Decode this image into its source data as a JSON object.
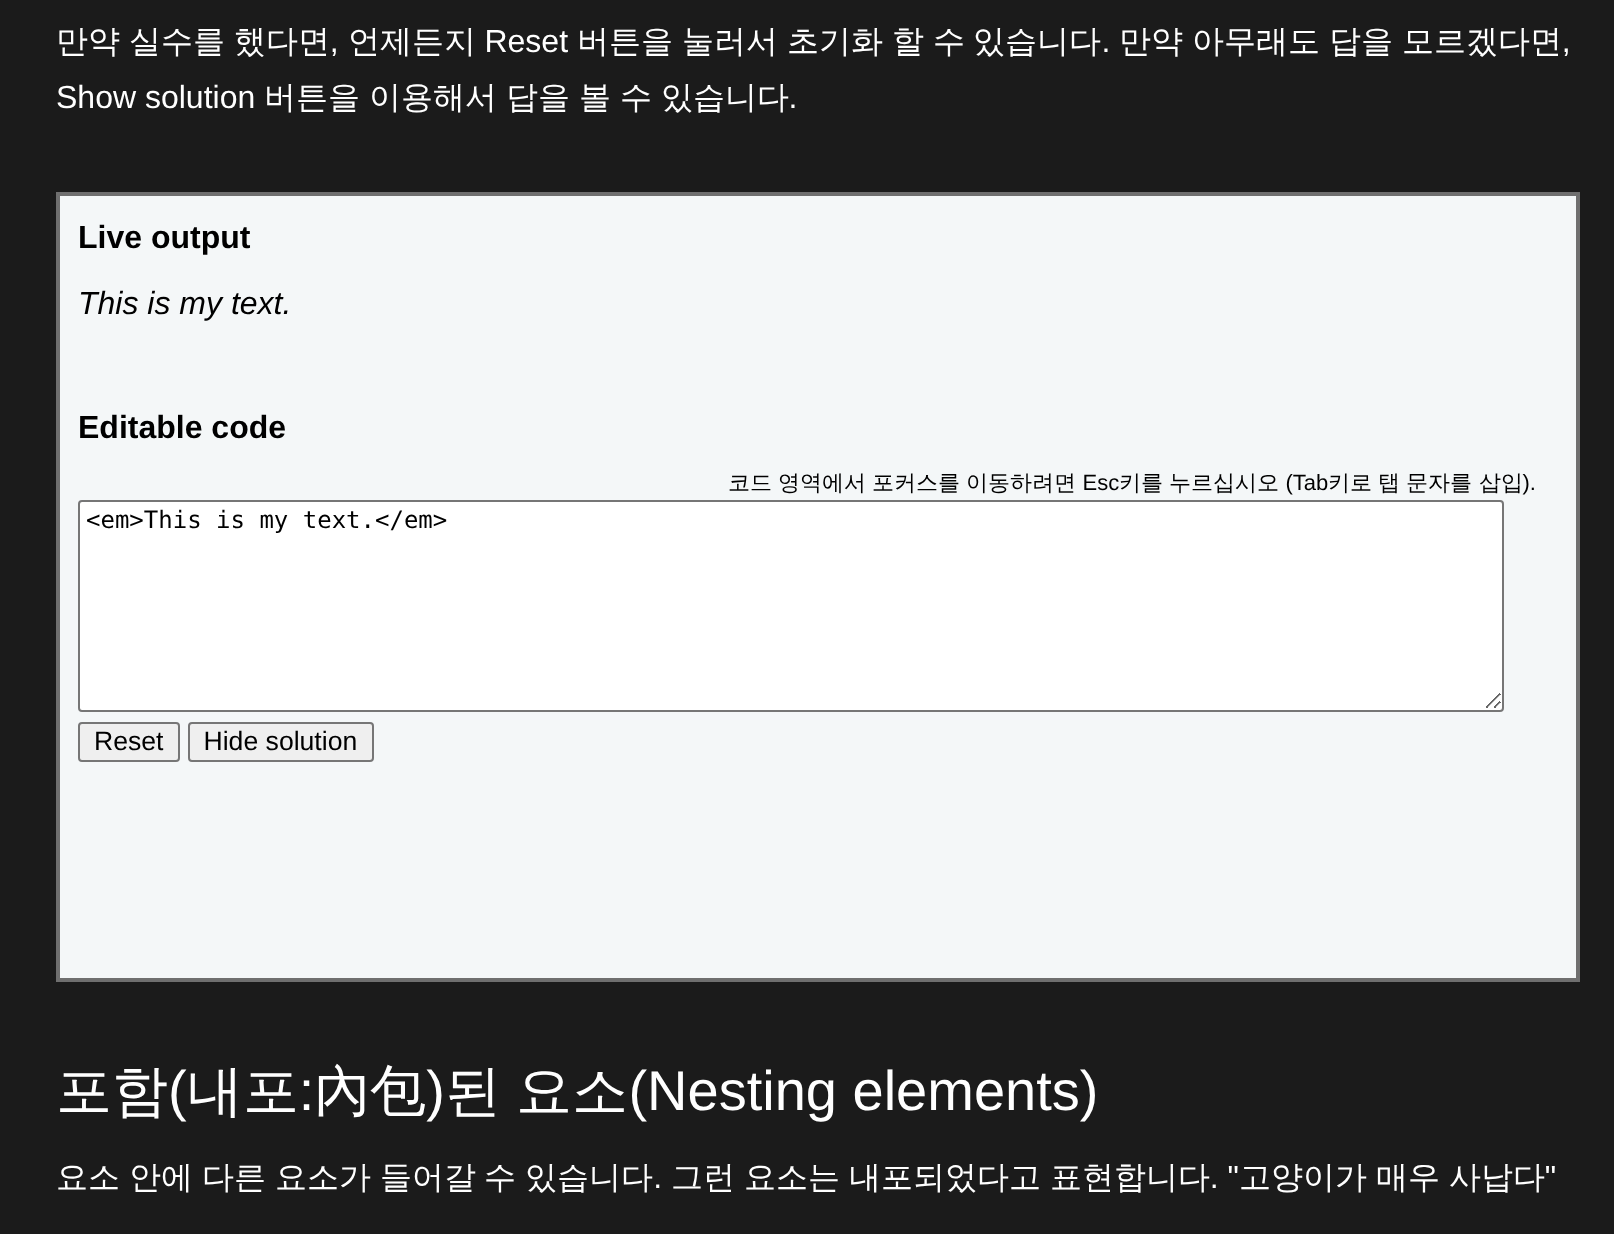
{
  "intro": "만약 실수를 했다면, 언제든지 Reset 버튼을 눌러서 초기화 할 수 있습니다. 만약 아무래도 답을 모르겠다면, Show solution 버튼을 이용해서 답을 볼 수 있습니다.",
  "example": {
    "output_heading": "Live output",
    "output_text": "This is my text.",
    "code_heading": "Editable code",
    "hint": "코드 영역에서 포커스를 이동하려면 Esc키를 누르십시오 (Tab키로 탭 문자를 삽입).",
    "code": "<em>This is my text.</em>",
    "buttons": [
      {
        "label": "Reset"
      },
      {
        "label": "Hide solution"
      }
    ]
  },
  "section": {
    "heading": "포함(내포:內包)된 요소(Nesting elements)",
    "text": "요소 안에 다른 요소가 들어갈 수 있습니다. 그런 요소는 내포되었다고 표현합니다. \"고양이가 매우 사납다\""
  }
}
